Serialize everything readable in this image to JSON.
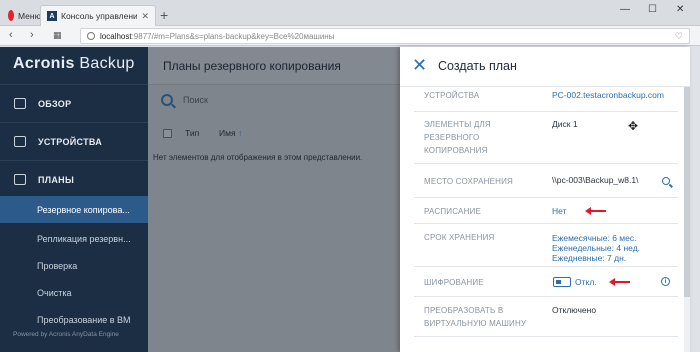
{
  "browser": {
    "menu_label": "Меню",
    "tab_title": "Консоль управления резер",
    "tab_favicon": "A",
    "url_host": "localhost",
    "url_rest": ":9877/#m=Plans&s=plans-backup&key=Все%20машины",
    "icons": [
      "opera-logo-icon",
      "close-icon",
      "new-tab-icon",
      "back-icon",
      "forward-icon",
      "tab-grid-icon",
      "globe-icon",
      "heart-icon"
    ]
  },
  "sidebar": {
    "logo_brand": "Acronis",
    "logo_product": "Backup",
    "nav": [
      {
        "label": "ОБЗОР"
      },
      {
        "label": "УСТРОЙСТВА"
      },
      {
        "label": "ПЛАНЫ"
      }
    ],
    "subnav": [
      {
        "label": "Резервное копирова..."
      },
      {
        "label": "Репликация резервн..."
      },
      {
        "label": "Проверка"
      },
      {
        "label": "Очистка"
      },
      {
        "label": "Преобразование в ВМ"
      }
    ],
    "powered_by": "Powered by Acronis AnyData Engine"
  },
  "main": {
    "title": "Планы резервного копирования",
    "search_placeholder": "Поиск",
    "col_type": "Тип",
    "col_name": "Имя",
    "sort_arrow": "↑",
    "empty_message": "Нет элементов для отображения в этом представлении."
  },
  "panel": {
    "close_glyph": "✕",
    "title": "Создать план",
    "devices_label": "УСТРОЙСТВА",
    "devices_value": "PC-002.testacronbackup.com",
    "items_label_1": "ЭЛЕМЕНТЫ ДЛЯ",
    "items_label_2": "РЕЗЕРВНОГО",
    "items_label_3": "КОПИРОВАНИЯ",
    "items_value": "Диск 1",
    "location_label": "МЕСТО СОХРАНЕНИЯ",
    "location_value": "\\\\pc-003\\Backup_w8.1\\",
    "schedule_label": "РАСПИСАНИЕ",
    "schedule_value": "Нет",
    "retention_label": "СРОК ХРАНЕНИЯ",
    "retention_monthly": "Ежемесячные: 6 мес.",
    "retention_weekly": "Еженедельные: 4 нед.",
    "retention_daily": "Ежедневные: 7 дн.",
    "encryption_label": "ШИФРОВАНИЕ",
    "encryption_value": "Откл.",
    "convert_label_1": "ПРЕОБРАЗОВАТЬ В",
    "convert_label_2": "ВИРТУАЛЬНУЮ МАШИНУ",
    "convert_value": "Отключено"
  },
  "colors": {
    "sidebar_bg": "#1c2e44",
    "active_item": "#2c5a8a",
    "link_blue": "#2c6fb0",
    "annotation_red": "#e0182a",
    "overlay_gray": "#7f858c"
  }
}
